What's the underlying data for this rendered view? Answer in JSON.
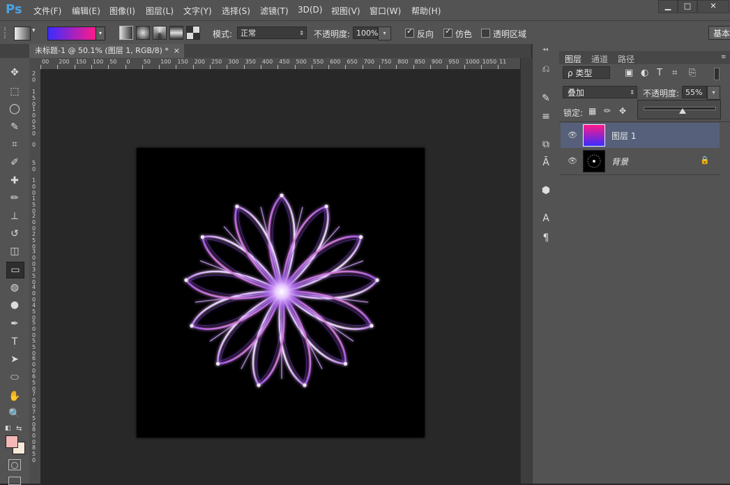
{
  "app": {
    "logo": "Ps"
  },
  "menu": [
    "文件(F)",
    "编辑(E)",
    "图像(I)",
    "图层(L)",
    "文字(Y)",
    "选择(S)",
    "滤镜(T)",
    "3D(D)",
    "视图(V)",
    "窗口(W)",
    "帮助(H)"
  ],
  "window_controls": {
    "minimize": "▁",
    "maximize": "□",
    "close": "✕"
  },
  "options": {
    "mode_label": "模式:",
    "mode_value": "正常",
    "opacity_label": "不透明度:",
    "opacity_value": "100%",
    "reverse_label": "反向",
    "dither_label": "仿色",
    "transparency_label": "透明区域",
    "workspace_button": "基本",
    "gradient_colors": [
      "#3a2cff",
      "#ff1a8a"
    ]
  },
  "document": {
    "tab_title": "未标题-1 @ 50.1% (图层 1, RGB/8) *",
    "close": "×"
  },
  "ruler": {
    "h_ticks": [
      "00",
      "200",
      "150",
      "100",
      "50",
      "0",
      "50",
      "100",
      "150",
      "200",
      "250",
      "300",
      "350",
      "400",
      "450",
      "500",
      "550",
      "600",
      "650",
      "700",
      "750",
      "800",
      "850",
      "900",
      "950",
      "1000",
      "1050",
      "11"
    ],
    "v_ticks": [
      "20",
      "150",
      "100",
      "50",
      "0",
      "50",
      "100",
      "150",
      "200",
      "250",
      "300",
      "350",
      "400",
      "450",
      "500",
      "550",
      "600",
      "650",
      "700",
      "750",
      "800",
      "850"
    ]
  },
  "tools": [
    "move",
    "marquee",
    "lasso",
    "quick-select",
    "crop",
    "eyedropper",
    "healing",
    "brush",
    "stamp",
    "history-brush",
    "eraser",
    "gradient",
    "blur",
    "dodge",
    "pen",
    "type",
    "path-select",
    "shape",
    "hand",
    "zoom"
  ],
  "tool_glyphs": {
    "move": "✥",
    "marquee": "⬚",
    "lasso": "◯",
    "quick-select": "✎",
    "crop": "⌗",
    "eyedropper": "✐",
    "healing": "✚",
    "brush": "✏",
    "stamp": "⊥",
    "history-brush": "↺",
    "eraser": "◫",
    "gradient": "▭",
    "blur": "◍",
    "dodge": "●",
    "pen": "✒",
    "type": "T",
    "path-select": "➤",
    "shape": "⬭",
    "hand": "✋",
    "zoom": "🔍"
  },
  "colors": {
    "foreground": "#f5b8b8",
    "background": "#f7ead9",
    "accent_selected_layer": "#56607a"
  },
  "panel": {
    "tabs": [
      "图层",
      "通道",
      "路径"
    ],
    "filter_kind": "ρ 类型",
    "blend_mode": "叠加",
    "opacity_label": "不透明度:",
    "opacity_value": "55%",
    "lock_label": "锁定:",
    "layers": [
      {
        "name": "图层 1",
        "selected": true
      },
      {
        "name": "背景",
        "selected": false
      }
    ]
  },
  "dock_icons": [
    "history-icon",
    "brush-presets-icon",
    "adjust-icon",
    "clone-source-icon",
    "character-style-icon",
    "3d-icon",
    "character-icon",
    "paragraph-icon"
  ]
}
